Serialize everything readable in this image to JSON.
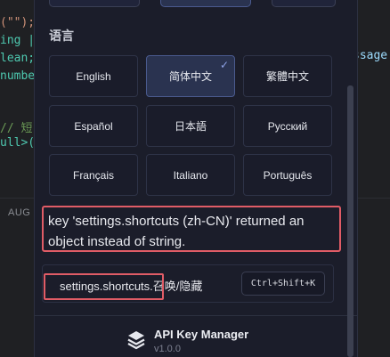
{
  "editor": {
    "lines_left": [
      {
        "tokens": [
          {
            "t": "(\"\");",
            "c": "c-str"
          }
        ]
      },
      {
        "tokens": [
          {
            "t": "ing |",
            "c": "c-type"
          }
        ]
      },
      {
        "tokens": [
          {
            "t": "lean;",
            "c": "c-type"
          }
        ]
      },
      {
        "tokens": [
          {
            "t": "numbe",
            "c": "c-type"
          }
        ]
      },
      {
        "tokens": [
          {
            "t": "// 短",
            "c": "c-comment"
          }
        ]
      },
      {
        "tokens": [
          {
            "t": "ull>(",
            "c": "c-type"
          }
        ]
      }
    ],
    "right_fragment": "ssage:",
    "section_label": "AUG"
  },
  "panel": {
    "section_title": "语言",
    "languages": [
      {
        "label": "English",
        "active": false
      },
      {
        "label": "简体中文",
        "active": true
      },
      {
        "label": "繁體中文",
        "active": false
      },
      {
        "label": "Español",
        "active": false
      },
      {
        "label": "日本語",
        "active": false
      },
      {
        "label": "Русский",
        "active": false
      },
      {
        "label": "Français",
        "active": false
      },
      {
        "label": "Italiano",
        "active": false
      },
      {
        "label": "Português",
        "active": false
      }
    ],
    "selected_check": "✓",
    "error_message": "key 'settings.shortcuts (zh-CN)' returned an object instead of string.",
    "shortcut_label": "settings.shortcuts.召唤/隐藏",
    "shortcut_keys": "Ctrl+Shift+K",
    "app_name": "API Key Manager",
    "app_version": "v1.0.0",
    "app_icon": "layers-icon"
  }
}
